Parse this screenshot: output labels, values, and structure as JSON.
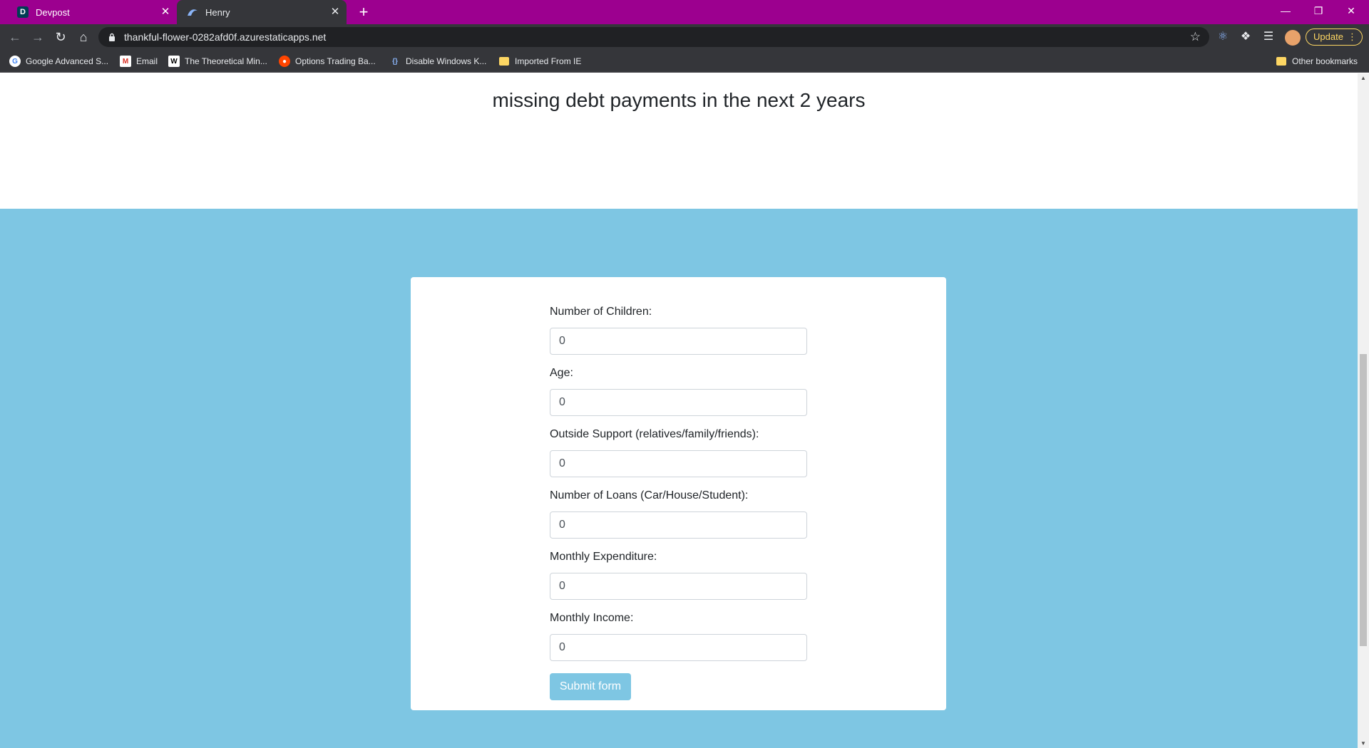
{
  "browser": {
    "tabs": [
      {
        "title": "Devpost",
        "favicon": "D"
      },
      {
        "title": "Henry",
        "favicon": "henry-icon"
      }
    ],
    "new_tab": "+",
    "close_glyph": "✕",
    "url": "thankful-flower-0282afd0f.azurestaticapps.net",
    "update_label": "Update",
    "bookmarks": [
      {
        "label": "Google Advanced S...",
        "icon": "google-icon"
      },
      {
        "label": "Email",
        "icon": "gmail-icon"
      },
      {
        "label": "The Theoretical Min...",
        "icon": "wikipedia-icon"
      },
      {
        "label": "Options Trading Ba...",
        "icon": "reddit-icon"
      },
      {
        "label": "Disable Windows K...",
        "icon": "bracket-icon"
      },
      {
        "label": "Imported From IE",
        "icon": "folder-icon"
      }
    ],
    "other_bookmarks": "Other bookmarks"
  },
  "page": {
    "headline": "missing debt payments in the next 2 years",
    "form": {
      "fields": [
        {
          "label": "Number of Children:",
          "value": "0"
        },
        {
          "label": "Age:",
          "value": "0"
        },
        {
          "label": "Outside Support (relatives/family/friends):",
          "value": "0"
        },
        {
          "label": "Number of Loans (Car/House/Student):",
          "value": "0"
        },
        {
          "label": "Monthly Expenditure:",
          "value": "0"
        },
        {
          "label": "Monthly Income:",
          "value": "0"
        }
      ],
      "submit_label": "Submit form"
    }
  },
  "colors": {
    "tabstrip": "#9c008f",
    "section_bg": "#7ec6e3",
    "button_bg": "#7ec6e3"
  }
}
